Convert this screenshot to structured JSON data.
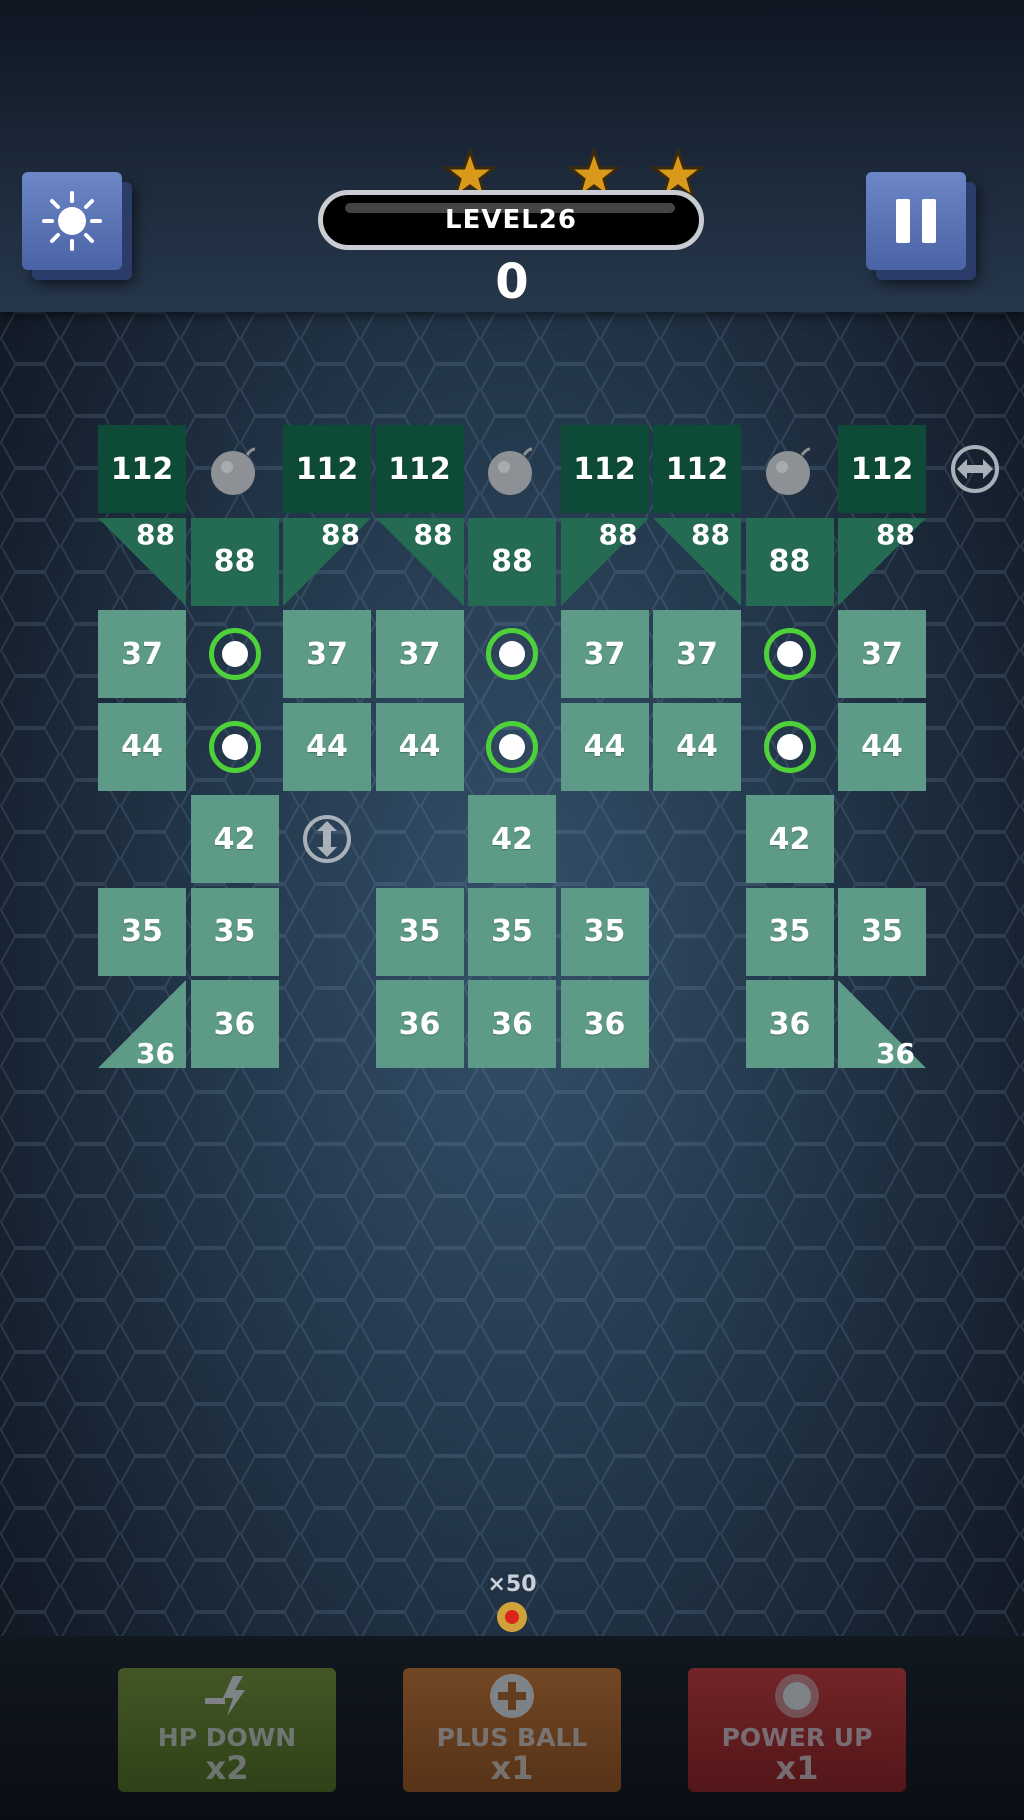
{
  "header": {
    "level_label": "LEVEL26",
    "score": "0",
    "stars_earned": 3,
    "stars_total": 3
  },
  "buttons": {
    "settings_icon": "brightness-icon",
    "pause_icon": "pause-icon"
  },
  "board": {
    "rows": [
      {
        "cells": [
          {
            "type": "block",
            "value": "112",
            "shade": "dark"
          },
          {
            "type": "bomb"
          },
          {
            "type": "block",
            "value": "112",
            "shade": "dark"
          },
          {
            "type": "block",
            "value": "112",
            "shade": "dark"
          },
          {
            "type": "bomb"
          },
          {
            "type": "block",
            "value": "112",
            "shade": "dark"
          },
          {
            "type": "block",
            "value": "112",
            "shade": "dark"
          },
          {
            "type": "bomb"
          },
          {
            "type": "block",
            "value": "112",
            "shade": "dark"
          },
          {
            "type": "horizontal-arrow"
          }
        ]
      },
      {
        "cells": [
          {
            "type": "triangle",
            "value": "88",
            "corner": "top-right",
            "shade": "mid"
          },
          {
            "type": "block",
            "value": "88",
            "shade": "mid"
          },
          {
            "type": "triangle",
            "value": "88",
            "corner": "top-left",
            "shade": "mid"
          },
          {
            "type": "triangle",
            "value": "88",
            "corner": "top-right",
            "shade": "mid"
          },
          {
            "type": "block",
            "value": "88",
            "shade": "mid"
          },
          {
            "type": "triangle",
            "value": "88",
            "corner": "top-left",
            "shade": "mid"
          },
          {
            "type": "triangle",
            "value": "88",
            "corner": "top-right",
            "shade": "mid"
          },
          {
            "type": "block",
            "value": "88",
            "shade": "mid"
          },
          {
            "type": "triangle",
            "value": "88",
            "corner": "top-left",
            "shade": "mid"
          }
        ]
      },
      {
        "cells": [
          {
            "type": "block",
            "value": "37",
            "shade": "light"
          },
          {
            "type": "ball-ring"
          },
          {
            "type": "block",
            "value": "37",
            "shade": "light"
          },
          {
            "type": "block",
            "value": "37",
            "shade": "light"
          },
          {
            "type": "ball-ring"
          },
          {
            "type": "block",
            "value": "37",
            "shade": "light"
          },
          {
            "type": "block",
            "value": "37",
            "shade": "light"
          },
          {
            "type": "ball-ring"
          },
          {
            "type": "block",
            "value": "37",
            "shade": "light"
          }
        ]
      },
      {
        "cells": [
          {
            "type": "block",
            "value": "44",
            "shade": "light"
          },
          {
            "type": "ball-ring"
          },
          {
            "type": "block",
            "value": "44",
            "shade": "light"
          },
          {
            "type": "block",
            "value": "44",
            "shade": "light"
          },
          {
            "type": "ball-ring"
          },
          {
            "type": "block",
            "value": "44",
            "shade": "light"
          },
          {
            "type": "block",
            "value": "44",
            "shade": "light"
          },
          {
            "type": "ball-ring"
          },
          {
            "type": "block",
            "value": "44",
            "shade": "light"
          }
        ]
      },
      {
        "cells": [
          {
            "type": "empty"
          },
          {
            "type": "block",
            "value": "42",
            "shade": "light"
          },
          {
            "type": "vertical-arrow"
          },
          {
            "type": "empty"
          },
          {
            "type": "block",
            "value": "42",
            "shade": "light"
          },
          {
            "type": "empty"
          },
          {
            "type": "empty"
          },
          {
            "type": "block",
            "value": "42",
            "shade": "light"
          },
          {
            "type": "empty"
          }
        ]
      },
      {
        "cells": [
          {
            "type": "block",
            "value": "35",
            "shade": "light"
          },
          {
            "type": "block",
            "value": "35",
            "shade": "light"
          },
          {
            "type": "empty"
          },
          {
            "type": "block",
            "value": "35",
            "shade": "light"
          },
          {
            "type": "block",
            "value": "35",
            "shade": "light"
          },
          {
            "type": "block",
            "value": "35",
            "shade": "light"
          },
          {
            "type": "empty"
          },
          {
            "type": "block",
            "value": "35",
            "shade": "light"
          },
          {
            "type": "block",
            "value": "35",
            "shade": "light"
          }
        ]
      },
      {
        "cells": [
          {
            "type": "triangle",
            "value": "36",
            "corner": "bottom-right",
            "shade": "light"
          },
          {
            "type": "block",
            "value": "36",
            "shade": "light"
          },
          {
            "type": "empty"
          },
          {
            "type": "block",
            "value": "36",
            "shade": "light"
          },
          {
            "type": "block",
            "value": "36",
            "shade": "light"
          },
          {
            "type": "block",
            "value": "36",
            "shade": "light"
          },
          {
            "type": "empty"
          },
          {
            "type": "block",
            "value": "36",
            "shade": "light"
          },
          {
            "type": "triangle",
            "value": "36",
            "corner": "bottom-left",
            "shade": "light"
          }
        ]
      }
    ]
  },
  "launcher": {
    "ball_count": "×50"
  },
  "powerups": [
    {
      "label": "HP DOWN",
      "count": "x2",
      "icon": "lightning-down-icon",
      "color": "#5b7b22"
    },
    {
      "label": "PLUS BALL",
      "count": "x1",
      "icon": "plus-icon",
      "color": "#ab6022"
    },
    {
      "label": "POWER UP",
      "count": "x1",
      "icon": "orb-icon",
      "color": "#a92626"
    }
  ],
  "colors": {
    "block_dark": "#0e4a38",
    "block_mid": "#256a53",
    "block_light": "#5e9a88",
    "ring_green": "#4fd13a"
  }
}
